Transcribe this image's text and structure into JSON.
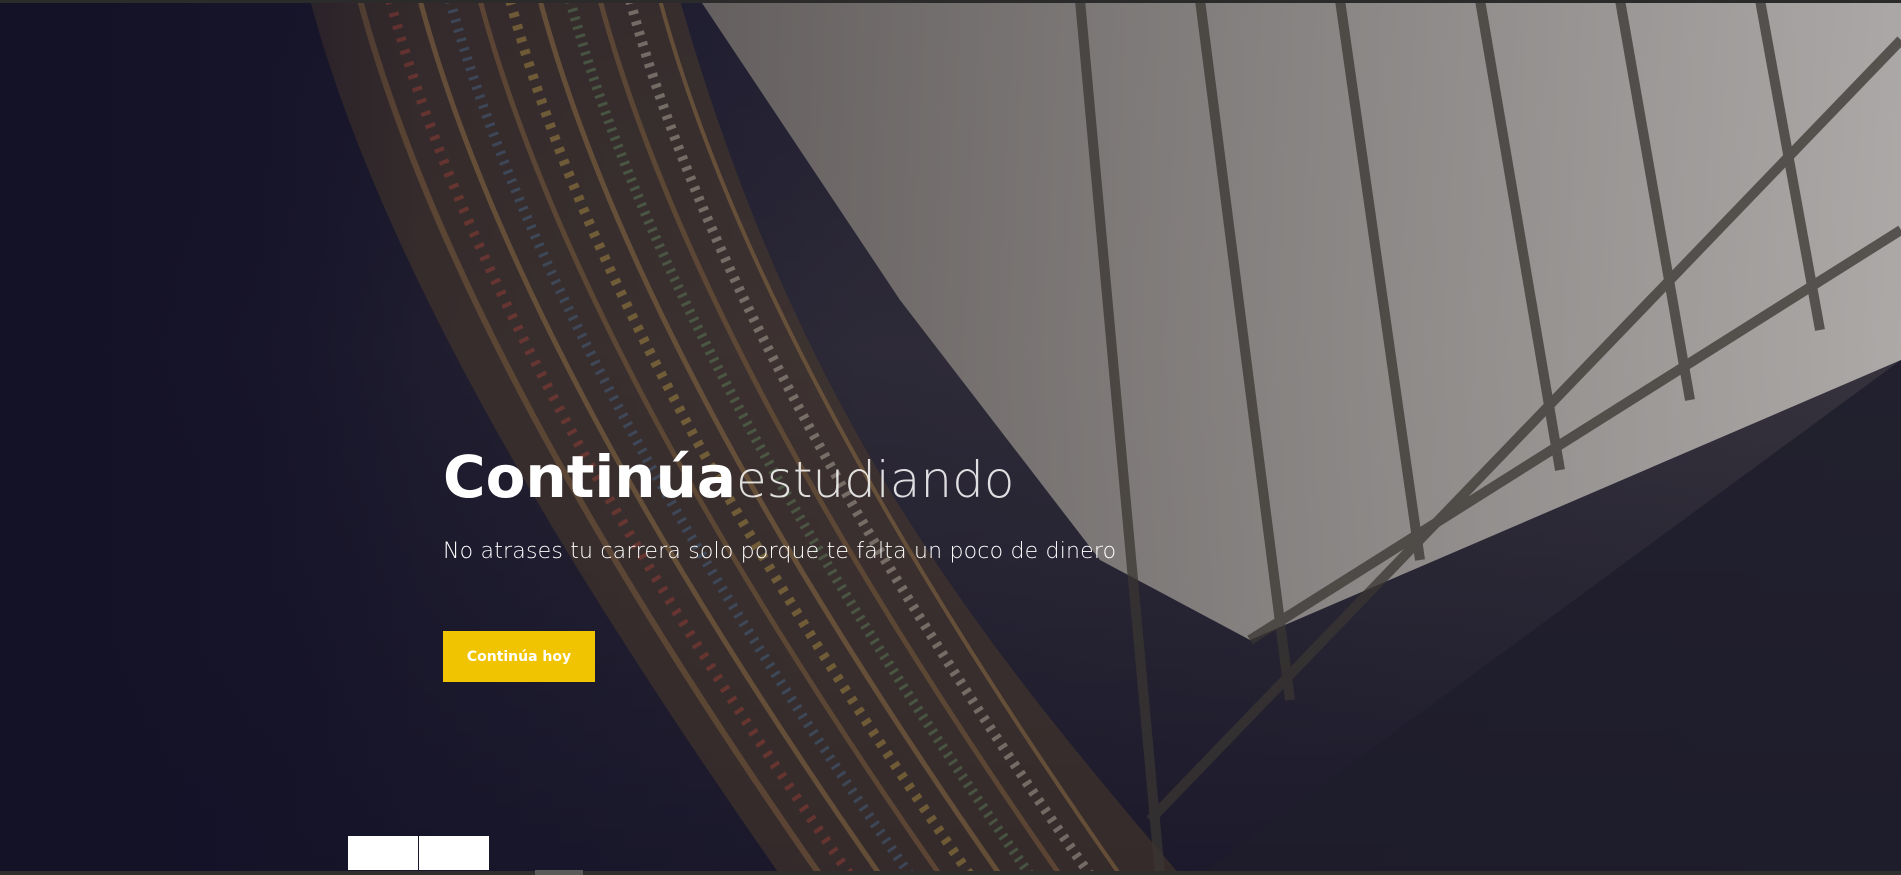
{
  "hero": {
    "title_strong": "Continúa",
    "title_light": "estudiando",
    "subtitle": "No atrases tu carrera solo porque te falta un poco de dinero",
    "cta_label": "Continúa hoy",
    "cta_color": "#f0c400",
    "background_image": "library-bookshelves"
  },
  "slider": {
    "buttons": [
      "",
      ""
    ]
  }
}
